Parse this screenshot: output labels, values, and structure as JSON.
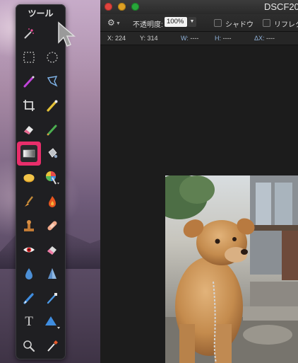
{
  "palette": {
    "title": "ツール",
    "tools": [
      {
        "name": "magic-wand-icon"
      },
      {
        "name": "pointer-tool-icon"
      },
      {
        "name": "rect-select-icon"
      },
      {
        "name": "ellipse-select-icon"
      },
      {
        "name": "brush-select-icon"
      },
      {
        "name": "lasso-icon"
      },
      {
        "name": "crop-icon"
      },
      {
        "name": "eyedropper-icon"
      },
      {
        "name": "eraser-icon"
      },
      {
        "name": "pencil-icon"
      },
      {
        "name": "gradient-icon"
      },
      {
        "name": "paint-bucket-icon"
      },
      {
        "name": "sponge-icon"
      },
      {
        "name": "color-wheel-icon"
      },
      {
        "name": "smudge-brush-icon"
      },
      {
        "name": "burn-icon"
      },
      {
        "name": "clone-stamp-icon"
      },
      {
        "name": "heal-bandage-icon"
      },
      {
        "name": "red-eye-icon"
      },
      {
        "name": "eraser-pink-icon"
      },
      {
        "name": "blur-drop-icon"
      },
      {
        "name": "sharpen-icon"
      },
      {
        "name": "pen-icon"
      },
      {
        "name": "vector-pen-icon"
      },
      {
        "name": "text-tool-icon"
      },
      {
        "name": "shape-icon"
      },
      {
        "name": "zoom-icon"
      },
      {
        "name": "color-picker-icon"
      }
    ],
    "text_tool_glyph": "T",
    "selected_tool": "gradient-icon",
    "accent": "#e82e6b"
  },
  "window": {
    "title": "DSCF20",
    "toolbar": {
      "opacity_label": "不透明度:",
      "opacity_value": "100%",
      "shadow_label": "シャドウ",
      "reflect_label": "リフレク"
    },
    "info": {
      "x_label": "X:",
      "x_value": "224",
      "y_label": "Y:",
      "y_value": "314",
      "w_label": "W:",
      "w_value": "----",
      "h_label": "H:",
      "h_value": "----",
      "dx_label": "ΔX:",
      "dx_value": "----"
    }
  }
}
